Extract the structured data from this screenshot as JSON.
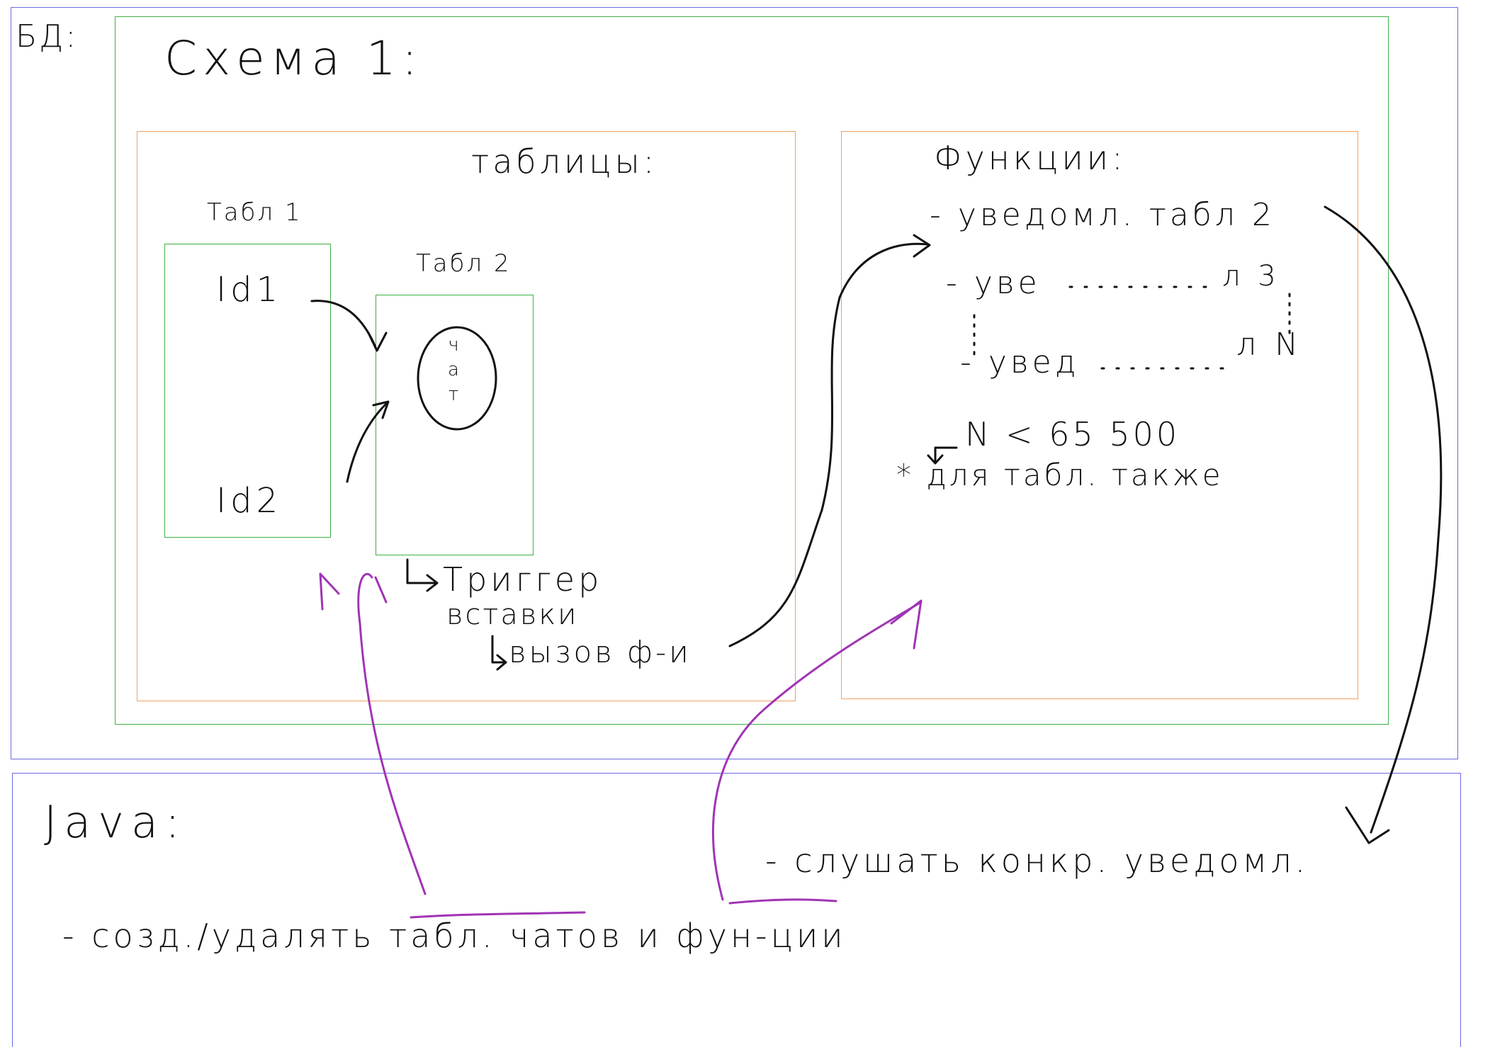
{
  "colors": {
    "db_frame": "#6a6adf",
    "java_frame": "#6a6adf",
    "schema_frame": "#3cb043",
    "section_frame": "#f0a060",
    "table_frame": "#3cb043",
    "ink": "#111111",
    "purple_ink": "#a034b4"
  },
  "db": {
    "label": "БД:"
  },
  "schema": {
    "label": "Схема 1:"
  },
  "tables_section": {
    "label": "таблицы:",
    "table1": {
      "label": "Табл 1",
      "field1": "Id1",
      "field2": "Id2"
    },
    "table2": {
      "label": "Табл 2",
      "chat": "ч а т"
    },
    "trigger_line1": "Триггер",
    "trigger_line2": "вставки",
    "call_line": "вызов ф-и"
  },
  "functions_section": {
    "label": "Функции:",
    "item1": "- уведомл. табл 2",
    "item2_start": "- уве",
    "item2_end": "л 3",
    "item3_start": "- увед",
    "item3_end": "л N",
    "n_limit": "N < 65 500",
    "note": "* для табл. также"
  },
  "java": {
    "label": "Java:",
    "listen": "- слушать конкр. уведомл.",
    "create": "- созд./удалять табл. чатов и фун-ции"
  },
  "icons": [
    "arrow-icon"
  ]
}
